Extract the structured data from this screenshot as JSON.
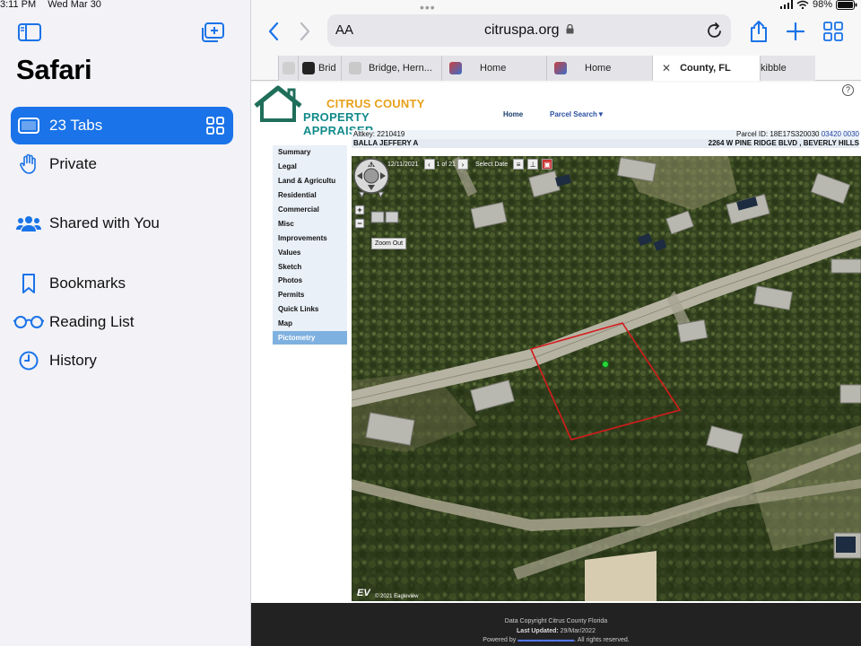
{
  "status_bar": {
    "time": "3:11 PM",
    "date": "Wed Mar 30",
    "battery": "98%"
  },
  "sidebar": {
    "title": "Safari",
    "items": [
      {
        "label": "23 Tabs",
        "icon": "tabs-icon",
        "active": true
      },
      {
        "label": "Private",
        "icon": "hand-icon"
      },
      {
        "label": "Shared with You",
        "icon": "people-icon"
      },
      {
        "label": "Bookmarks",
        "icon": "bookmark-icon"
      },
      {
        "label": "Reading List",
        "icon": "glasses-icon"
      },
      {
        "label": "History",
        "icon": "clock-icon"
      }
    ]
  },
  "browser": {
    "aa_label": "AA",
    "url": "citruspa.org",
    "tabs": [
      {
        "label": ""
      },
      {
        "label": "Brid"
      },
      {
        "label": "Bridge, Hern..."
      },
      {
        "label": "Home"
      },
      {
        "label": "Home"
      },
      {
        "label": "County, FL"
      },
      {
        "label": "kibble"
      }
    ]
  },
  "page": {
    "logo": {
      "line1": "CITRUS COUNTY",
      "line2": "PROPERTY APPRAISER"
    },
    "help": "?",
    "nav": {
      "home": "Home",
      "parcel_search": "Parcel Search▼"
    },
    "altkey": "Altkey: 2210419",
    "parcel_id_label": "Parcel ID: 18E17S320030",
    "parcel_id_link": "03420 0030",
    "owner": "BALLA JEFFERY A",
    "address": "2264 W PINE RIDGE BLVD , BEVERLY HILLS",
    "left_nav": [
      "Summary",
      "Legal",
      "Land & Agricultu",
      "Residential",
      "Commercial",
      "Misc",
      "Improvements",
      "Values",
      "Sketch",
      "Photos",
      "Permits",
      "Quick Links",
      "Map",
      "Pictometry"
    ],
    "active_nav": "Pictometry",
    "map": {
      "date": "12/11/2021",
      "page": "1 of 21",
      "select_date": "Select Date",
      "tooltip": "Zoom Out",
      "copyright": "© 2021 Eagleview",
      "zoom_in": "+",
      "zoom_out": "−",
      "compass_label": "N"
    },
    "footer": {
      "line1": "Data Copyright Citrus County Florida",
      "line2_label": "Last Updated:",
      "line2_value": "29/Mar/2022",
      "line3_prefix": "Powered by",
      "line3_suffix": ". All rights reserved."
    }
  }
}
